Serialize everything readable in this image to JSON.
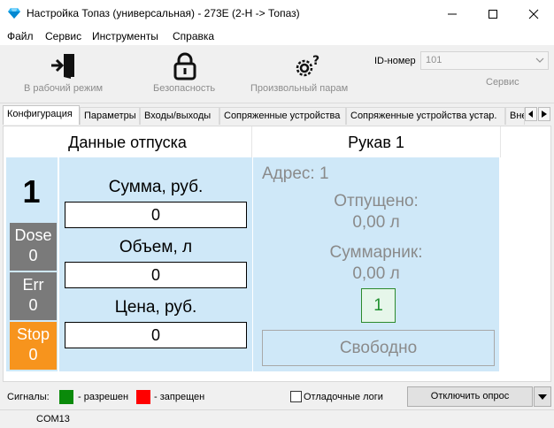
{
  "window": {
    "title": "Настройка Топаз (универсальная) - 273Е (2-Н -> Топаз)",
    "icon": "diamond-icon",
    "controls": [
      "minimize-icon",
      "maximize-icon",
      "close-icon"
    ]
  },
  "menu": {
    "items": [
      "Файл",
      "Сервис",
      "Инструменты",
      "Справка"
    ]
  },
  "toolbar": {
    "work_mode_label": "В рабочий режим",
    "security_label": "Безопасность",
    "param_label": "Произвольный парам",
    "id_label": "ID-номер",
    "id_value": "101",
    "service_label": "Сервис"
  },
  "tabs": [
    "Конфигурация",
    "Параметры",
    "Входы/выходы",
    "Сопряженные устройства",
    "Сопряженные устройства устар.",
    "Вне"
  ],
  "dispense": {
    "header": "Данные отпуска",
    "number": "1",
    "counters": [
      {
        "label": "Dose",
        "value": "0",
        "color": "#7a7a7a"
      },
      {
        "label": "Err",
        "value": "0",
        "color": "#7a7a7a"
      },
      {
        "label": "Stop",
        "value": "0",
        "color": "#f7941d"
      }
    ],
    "fields": [
      {
        "label": "Сумма, руб.",
        "value": "0"
      },
      {
        "label": "Объем, л",
        "value": "0"
      },
      {
        "label": "Цена, руб.",
        "value": "0"
      }
    ]
  },
  "sleeve": {
    "header": "Рукав 1",
    "address": "Адрес: 1",
    "released_label": "Отпущено:",
    "released_value": "0,00 л",
    "total_label": "Суммарник:",
    "total_value": "0,00 л",
    "badge": "1",
    "status_button": "Свободно"
  },
  "signals": {
    "label": "Сигналы:",
    "allowed_color": "#0a8a0a",
    "allowed_text": "- разрешен",
    "denied_color": "#ff0000",
    "denied_text": "- запрещен"
  },
  "debug_logs": {
    "label": "Отладочные логи",
    "checked": false
  },
  "disconnect_button": "Отключить опрос",
  "status": {
    "port": "COM13"
  }
}
